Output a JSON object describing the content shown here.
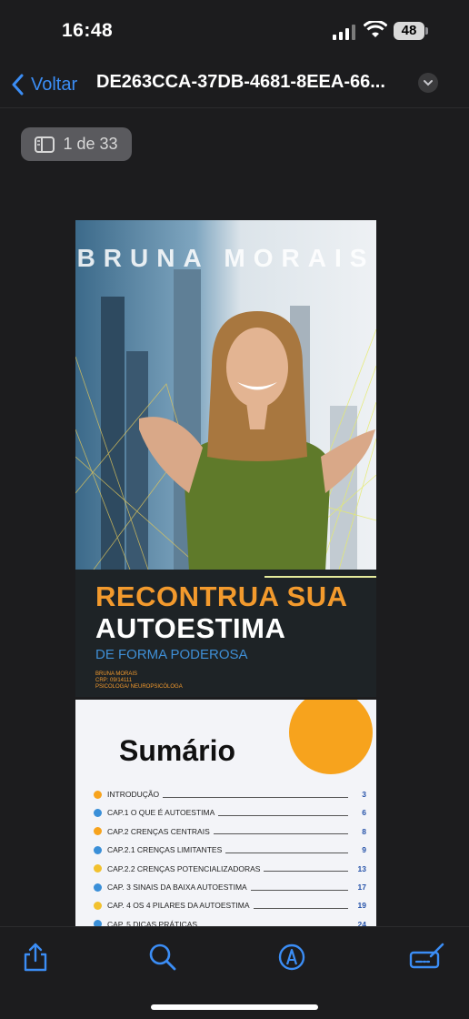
{
  "status_bar": {
    "time": "16:48",
    "battery": "48"
  },
  "nav": {
    "back_label": "Voltar",
    "title": "DE263CCA-37DB-4681-8EEA-66..."
  },
  "page_indicator": "1 de 33",
  "cover": {
    "author_name": "BRUNA MORAIS",
    "headline_line1": "RECONTRUA SUA",
    "headline_line2": "AUTOESTIMA",
    "subheadline": "DE FORMA PODEROSA",
    "meta": [
      "BRUNA MORAIS",
      "CRP: 09/14111",
      "PSICOLOGA/ NEUROPSICÓLOGA"
    ]
  },
  "summary": {
    "title": "Sumário",
    "items": [
      {
        "label": "INTRODUÇÃO",
        "page": "3",
        "color": "#f7a31d"
      },
      {
        "label": "CAP.1 O QUE É AUTOESTIMA",
        "page": "6",
        "color": "#3a8fd8"
      },
      {
        "label": "CAP.2 CRENÇAS CENTRAIS",
        "page": "8",
        "color": "#f7a31d"
      },
      {
        "label": "CAP.2.1 CRENÇAS LIMITANTES",
        "page": "9",
        "color": "#3a8fd8"
      },
      {
        "label": "CAP.2.2 CRENÇAS POTENCIALIZADORAS",
        "page": "13",
        "color": "#f2c12e"
      },
      {
        "label": "CAP. 3  SINAIS DA BAIXA AUTOESTIMA",
        "page": "17",
        "color": "#3a8fd8"
      },
      {
        "label": "CAP. 4 OS 4 PILARES DA AUTOESTIMA",
        "page": "19",
        "color": "#f2c12e"
      },
      {
        "label": "CAP. 5 DICAS PRÁTICAS",
        "page": "24",
        "color": "#3a8fd8"
      }
    ]
  },
  "toolbar": {
    "icons": [
      "share-icon",
      "search-icon",
      "markup-icon",
      "signature-icon"
    ],
    "accent": "#3b8df5"
  }
}
